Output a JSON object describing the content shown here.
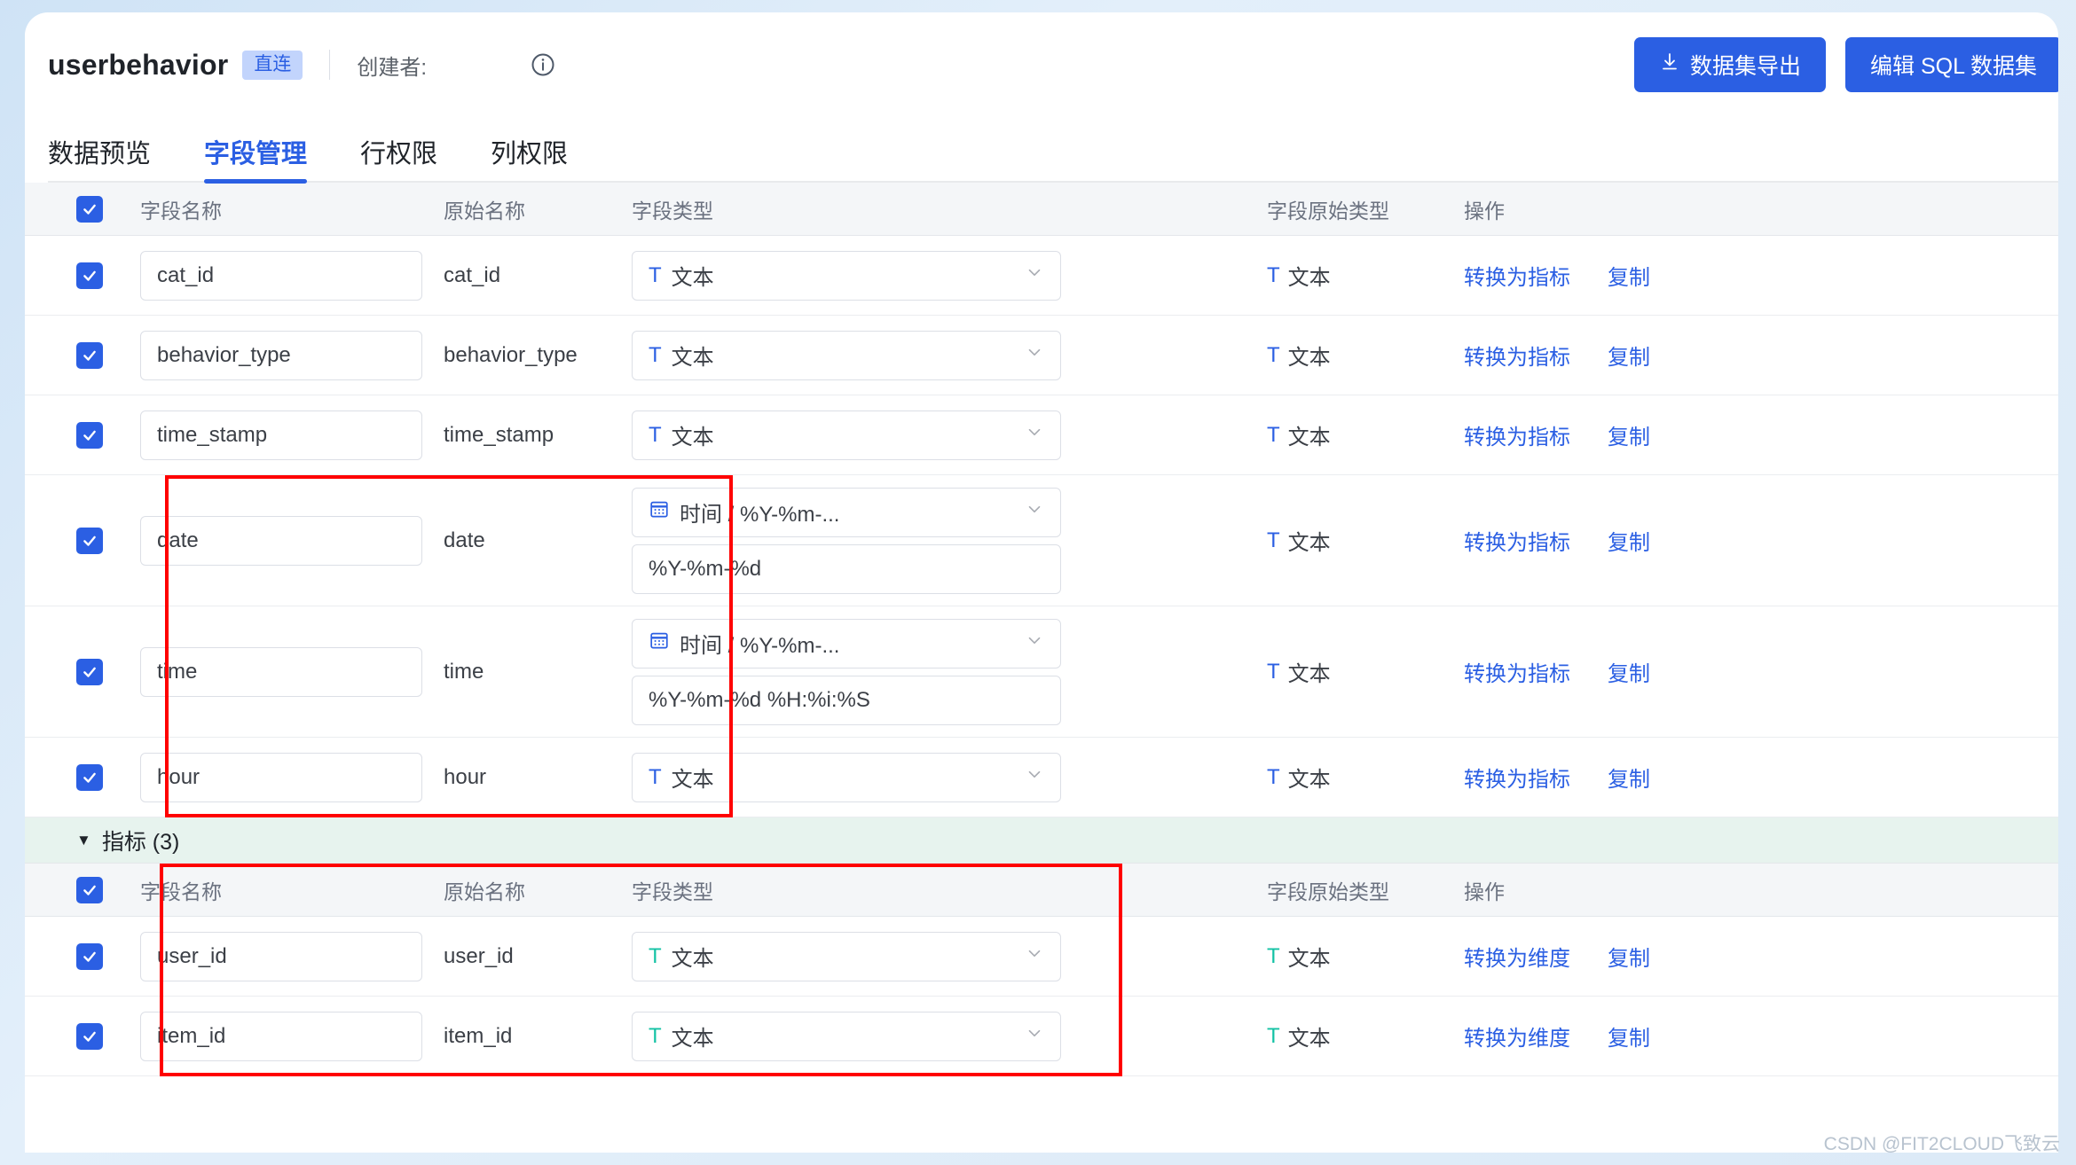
{
  "header": {
    "dataset_name": "userbehavior",
    "tag": "直连",
    "creator_label": "创建者:",
    "creator_name": "",
    "info_icon": "info-circle-icon",
    "export_button": "数据集导出",
    "export_icon": "download-icon",
    "edit_sql_button": "编辑 SQL 数据集"
  },
  "tabs": [
    {
      "label": "数据预览",
      "active": false
    },
    {
      "label": "字段管理",
      "active": true
    },
    {
      "label": "行权限",
      "active": false
    },
    {
      "label": "列权限",
      "active": false
    }
  ],
  "columns": {
    "field_name": "字段名称",
    "original_name": "原始名称",
    "field_type": "字段类型",
    "original_type": "字段原始类型",
    "actions": "操作"
  },
  "dimension_rows": [
    {
      "checked": true,
      "name": "cat_id",
      "original": "cat_id",
      "type": "文本",
      "type_icon": "text-T-icon",
      "type_icon_color": "#2b5fe3",
      "format": null,
      "original_type": "文本",
      "original_type_icon": "text-T-icon",
      "convert": "转换为指标",
      "copy": "复制"
    },
    {
      "checked": true,
      "name": "behavior_type",
      "original": "behavior_type",
      "type": "文本",
      "type_icon": "text-T-icon",
      "type_icon_color": "#2b5fe3",
      "format": null,
      "original_type": "文本",
      "original_type_icon": "text-T-icon",
      "convert": "转换为指标",
      "copy": "复制"
    },
    {
      "checked": true,
      "name": "time_stamp",
      "original": "time_stamp",
      "type": "文本",
      "type_icon": "text-T-icon",
      "type_icon_color": "#2b5fe3",
      "format": null,
      "original_type": "文本",
      "original_type_icon": "text-T-icon",
      "convert": "转换为指标",
      "copy": "复制"
    },
    {
      "checked": true,
      "name": "date",
      "original": "date",
      "type": "时间 / %Y-%m-...",
      "type_icon": "calendar-icon",
      "type_icon_color": "#2b5fe3",
      "format": "%Y-%m-%d",
      "original_type": "文本",
      "original_type_icon": "text-T-icon",
      "convert": "转换为指标",
      "copy": "复制"
    },
    {
      "checked": true,
      "name": "time",
      "original": "time",
      "type": "时间 / %Y-%m-...",
      "type_icon": "calendar-icon",
      "type_icon_color": "#2b5fe3",
      "format": "%Y-%m-%d %H:%i:%S",
      "original_type": "文本",
      "original_type_icon": "text-T-icon",
      "convert": "转换为指标",
      "copy": "复制"
    },
    {
      "checked": true,
      "name": "hour",
      "original": "hour",
      "type": "文本",
      "type_icon": "text-T-icon",
      "type_icon_color": "#2b5fe3",
      "format": null,
      "original_type": "文本",
      "original_type_icon": "text-T-icon",
      "convert": "转换为指标",
      "copy": "复制"
    }
  ],
  "metric_group": {
    "label": "指标 (3)",
    "expanded": true,
    "caret_icon": "caret-down-icon"
  },
  "metric_rows": [
    {
      "checked": true,
      "name": "user_id",
      "original": "user_id",
      "type": "文本",
      "type_icon": "text-T-icon",
      "type_icon_color": "#13c2a4",
      "original_type": "文本",
      "original_type_icon": "text-T-icon",
      "convert": "转换为维度",
      "copy": "复制"
    },
    {
      "checked": true,
      "name": "item_id",
      "original": "item_id",
      "type": "文本",
      "type_icon": "text-T-icon",
      "type_icon_color": "#13c2a4",
      "original_type": "文本",
      "original_type_icon": "text-T-icon",
      "convert": "转换为维度",
      "copy": "复制"
    }
  ],
  "header_checked": true,
  "metric_header_checked": true,
  "watermark": "CSDN @FIT2CLOUD飞致云",
  "colors": {
    "primary": "#2b5fe3",
    "metric_green": "#13c2a4",
    "annotation_red": "#ff0000",
    "group_bar_bg": "#e7f3ee",
    "table_head_bg": "#f4f6f8"
  }
}
